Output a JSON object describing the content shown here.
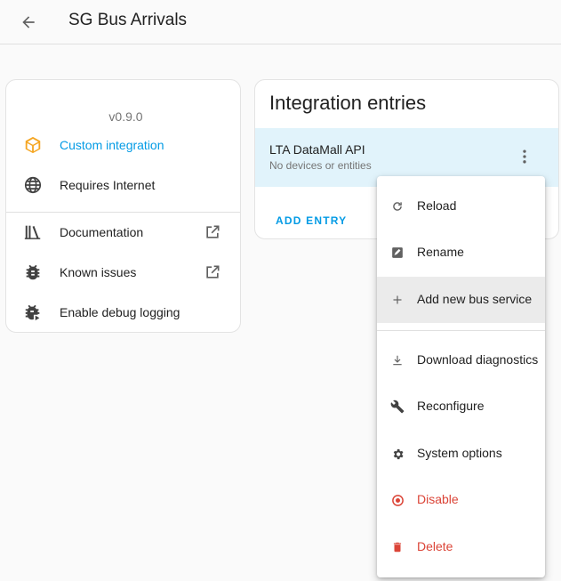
{
  "header": {
    "title": "SG Bus Arrivals"
  },
  "info": {
    "version": "v0.9.0",
    "rows": [
      {
        "label": "Custom integration",
        "icon": "package-icon"
      },
      {
        "label": "Requires Internet",
        "icon": "globe-icon"
      },
      {
        "label": "Documentation",
        "icon": "book-icon"
      },
      {
        "label": "Known issues",
        "icon": "bug-icon"
      },
      {
        "label": "Enable debug logging",
        "icon": "bug-play-icon"
      }
    ]
  },
  "entries": {
    "title": "Integration entries",
    "entry": {
      "name": "LTA DataMall API",
      "status": "No devices or entities"
    },
    "add_label": "ADD ENTRY"
  },
  "menu": {
    "items": [
      {
        "label": "Reload",
        "icon": "reload-icon"
      },
      {
        "label": "Rename",
        "icon": "rename-icon"
      },
      {
        "label": "Add new bus service",
        "icon": "plus-icon"
      },
      {
        "label": "Download diagnostics",
        "icon": "download-icon"
      },
      {
        "label": "Reconfigure",
        "icon": "wrench-icon"
      },
      {
        "label": "System options",
        "icon": "gear-icon"
      },
      {
        "label": "Disable",
        "icon": "disable-icon"
      },
      {
        "label": "Delete",
        "icon": "trash-icon"
      }
    ]
  },
  "colors": {
    "accent": "#039be5",
    "warning": "#db4437",
    "custom_icon": "#f5a623"
  }
}
